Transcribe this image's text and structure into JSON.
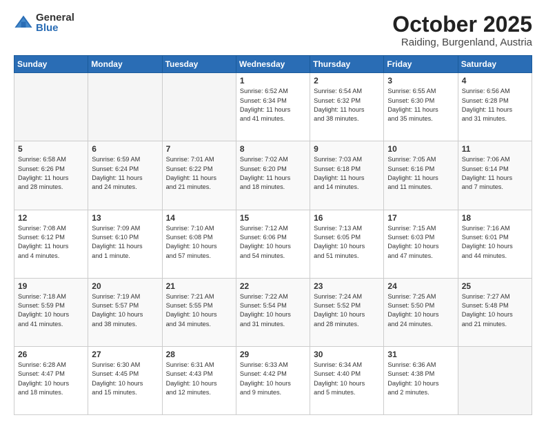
{
  "logo": {
    "general": "General",
    "blue": "Blue"
  },
  "header": {
    "month": "October 2025",
    "location": "Raiding, Burgenland, Austria"
  },
  "weekdays": [
    "Sunday",
    "Monday",
    "Tuesday",
    "Wednesday",
    "Thursday",
    "Friday",
    "Saturday"
  ],
  "weeks": [
    [
      {
        "day": "",
        "info": ""
      },
      {
        "day": "",
        "info": ""
      },
      {
        "day": "",
        "info": ""
      },
      {
        "day": "1",
        "info": "Sunrise: 6:52 AM\nSunset: 6:34 PM\nDaylight: 11 hours\nand 41 minutes."
      },
      {
        "day": "2",
        "info": "Sunrise: 6:54 AM\nSunset: 6:32 PM\nDaylight: 11 hours\nand 38 minutes."
      },
      {
        "day": "3",
        "info": "Sunrise: 6:55 AM\nSunset: 6:30 PM\nDaylight: 11 hours\nand 35 minutes."
      },
      {
        "day": "4",
        "info": "Sunrise: 6:56 AM\nSunset: 6:28 PM\nDaylight: 11 hours\nand 31 minutes."
      }
    ],
    [
      {
        "day": "5",
        "info": "Sunrise: 6:58 AM\nSunset: 6:26 PM\nDaylight: 11 hours\nand 28 minutes."
      },
      {
        "day": "6",
        "info": "Sunrise: 6:59 AM\nSunset: 6:24 PM\nDaylight: 11 hours\nand 24 minutes."
      },
      {
        "day": "7",
        "info": "Sunrise: 7:01 AM\nSunset: 6:22 PM\nDaylight: 11 hours\nand 21 minutes."
      },
      {
        "day": "8",
        "info": "Sunrise: 7:02 AM\nSunset: 6:20 PM\nDaylight: 11 hours\nand 18 minutes."
      },
      {
        "day": "9",
        "info": "Sunrise: 7:03 AM\nSunset: 6:18 PM\nDaylight: 11 hours\nand 14 minutes."
      },
      {
        "day": "10",
        "info": "Sunrise: 7:05 AM\nSunset: 6:16 PM\nDaylight: 11 hours\nand 11 minutes."
      },
      {
        "day": "11",
        "info": "Sunrise: 7:06 AM\nSunset: 6:14 PM\nDaylight: 11 hours\nand 7 minutes."
      }
    ],
    [
      {
        "day": "12",
        "info": "Sunrise: 7:08 AM\nSunset: 6:12 PM\nDaylight: 11 hours\nand 4 minutes."
      },
      {
        "day": "13",
        "info": "Sunrise: 7:09 AM\nSunset: 6:10 PM\nDaylight: 11 hours\nand 1 minute."
      },
      {
        "day": "14",
        "info": "Sunrise: 7:10 AM\nSunset: 6:08 PM\nDaylight: 10 hours\nand 57 minutes."
      },
      {
        "day": "15",
        "info": "Sunrise: 7:12 AM\nSunset: 6:06 PM\nDaylight: 10 hours\nand 54 minutes."
      },
      {
        "day": "16",
        "info": "Sunrise: 7:13 AM\nSunset: 6:05 PM\nDaylight: 10 hours\nand 51 minutes."
      },
      {
        "day": "17",
        "info": "Sunrise: 7:15 AM\nSunset: 6:03 PM\nDaylight: 10 hours\nand 47 minutes."
      },
      {
        "day": "18",
        "info": "Sunrise: 7:16 AM\nSunset: 6:01 PM\nDaylight: 10 hours\nand 44 minutes."
      }
    ],
    [
      {
        "day": "19",
        "info": "Sunrise: 7:18 AM\nSunset: 5:59 PM\nDaylight: 10 hours\nand 41 minutes."
      },
      {
        "day": "20",
        "info": "Sunrise: 7:19 AM\nSunset: 5:57 PM\nDaylight: 10 hours\nand 38 minutes."
      },
      {
        "day": "21",
        "info": "Sunrise: 7:21 AM\nSunset: 5:55 PM\nDaylight: 10 hours\nand 34 minutes."
      },
      {
        "day": "22",
        "info": "Sunrise: 7:22 AM\nSunset: 5:54 PM\nDaylight: 10 hours\nand 31 minutes."
      },
      {
        "day": "23",
        "info": "Sunrise: 7:24 AM\nSunset: 5:52 PM\nDaylight: 10 hours\nand 28 minutes."
      },
      {
        "day": "24",
        "info": "Sunrise: 7:25 AM\nSunset: 5:50 PM\nDaylight: 10 hours\nand 24 minutes."
      },
      {
        "day": "25",
        "info": "Sunrise: 7:27 AM\nSunset: 5:48 PM\nDaylight: 10 hours\nand 21 minutes."
      }
    ],
    [
      {
        "day": "26",
        "info": "Sunrise: 6:28 AM\nSunset: 4:47 PM\nDaylight: 10 hours\nand 18 minutes."
      },
      {
        "day": "27",
        "info": "Sunrise: 6:30 AM\nSunset: 4:45 PM\nDaylight: 10 hours\nand 15 minutes."
      },
      {
        "day": "28",
        "info": "Sunrise: 6:31 AM\nSunset: 4:43 PM\nDaylight: 10 hours\nand 12 minutes."
      },
      {
        "day": "29",
        "info": "Sunrise: 6:33 AM\nSunset: 4:42 PM\nDaylight: 10 hours\nand 9 minutes."
      },
      {
        "day": "30",
        "info": "Sunrise: 6:34 AM\nSunset: 4:40 PM\nDaylight: 10 hours\nand 5 minutes."
      },
      {
        "day": "31",
        "info": "Sunrise: 6:36 AM\nSunset: 4:38 PM\nDaylight: 10 hours\nand 2 minutes."
      },
      {
        "day": "",
        "info": ""
      }
    ]
  ]
}
